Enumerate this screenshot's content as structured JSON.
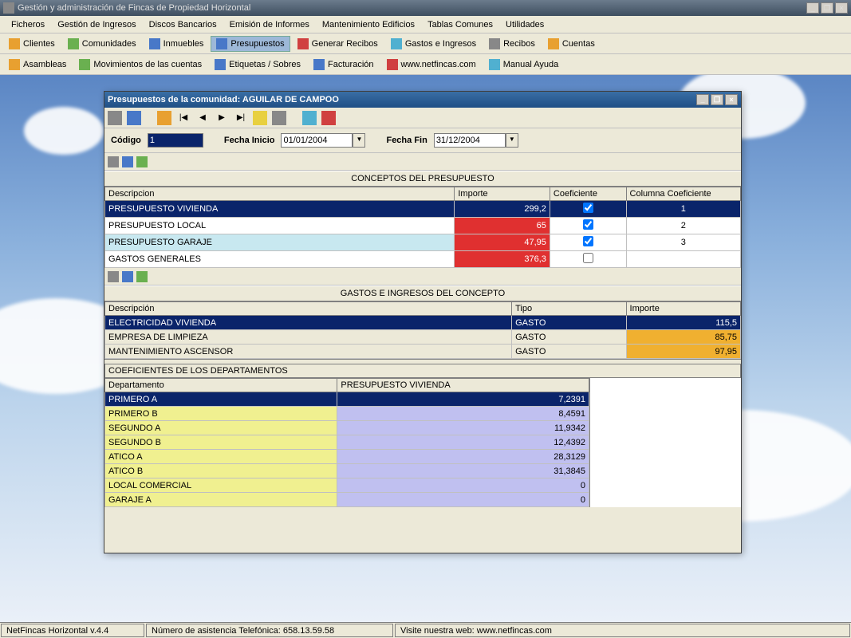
{
  "app": {
    "title": "Gestión y administración de Fincas de Propiedad Horizontal"
  },
  "menu": [
    "Ficheros",
    "Gestión de Ingresos",
    "Discos Bancarios",
    "Emisión de Informes",
    "Mantenimiento Edificios",
    "Tablas Comunes",
    "Utilidades"
  ],
  "toolbar1": [
    "Clientes",
    "Comunidades",
    "Inmuebles",
    "Presupuestos",
    "Generar Recibos",
    "Gastos e Ingresos",
    "Recibos",
    "Cuentas"
  ],
  "toolbar1_active": 3,
  "toolbar2": [
    "Asambleas",
    "Movimientos de las cuentas",
    "Etiquetas / Sobres",
    "Facturación",
    "www.netfincas.com",
    "Manual Ayuda"
  ],
  "inner": {
    "title": "Presupuestos de la comunidad: AGUILAR DE CAMPOO",
    "codigo_label": "Código",
    "codigo_value": "1",
    "fecha_inicio_label": "Fecha Inicio",
    "fecha_inicio_value": "01/01/2004",
    "fecha_fin_label": "Fecha Fin",
    "fecha_fin_value": "31/12/2004"
  },
  "conceptos": {
    "title": "CONCEPTOS DEL PRESUPUESTO",
    "cols": [
      "Descripcion",
      "Importe",
      "Coeficiente",
      "Columna Coeficiente"
    ],
    "rows": [
      {
        "desc": "PRESUPUESTO VIVIENDA",
        "importe": "299,2",
        "coef": true,
        "col": "1",
        "sel": true,
        "red": false
      },
      {
        "desc": "PRESUPUESTO LOCAL",
        "importe": "65",
        "coef": true,
        "col": "2",
        "sel": false,
        "red": true
      },
      {
        "desc": "PRESUPUESTO GARAJE",
        "importe": "47,95",
        "coef": true,
        "col": "3",
        "sel": false,
        "red": true
      },
      {
        "desc": "GASTOS GENERALES",
        "importe": "376,3",
        "coef": false,
        "col": "",
        "sel": false,
        "red": true
      }
    ]
  },
  "gastos": {
    "title": "GASTOS E INGRESOS DEL CONCEPTO",
    "cols": [
      "Descripción",
      "Tipo",
      "Importe"
    ],
    "rows": [
      {
        "desc": "ELECTRICIDAD VIVIENDA",
        "tipo": "GASTO",
        "importe": "115,5",
        "sel": true,
        "hl": false
      },
      {
        "desc": "EMPRESA DE LIMPIEZA",
        "tipo": "GASTO",
        "importe": "85,75",
        "sel": false,
        "hl": true
      },
      {
        "desc": "MANTENIMIENTO ASCENSOR",
        "tipo": "GASTO",
        "importe": "97,95",
        "sel": false,
        "hl": true
      }
    ]
  },
  "coef": {
    "title": "COEFICIENTES DE LOS DEPARTAMENTOS",
    "cols": [
      "Departamento",
      "PRESUPUESTO VIVIENDA"
    ],
    "rows": [
      {
        "dept": "PRIMERO A",
        "val": "7,2391",
        "sel": true
      },
      {
        "dept": "PRIMERO B",
        "val": "8,4591",
        "sel": false
      },
      {
        "dept": "SEGUNDO A",
        "val": "11,9342",
        "sel": false
      },
      {
        "dept": "SEGUNDO B",
        "val": "12,4392",
        "sel": false
      },
      {
        "dept": "ATICO A",
        "val": "28,3129",
        "sel": false
      },
      {
        "dept": "ATICO B",
        "val": "31,3845",
        "sel": false
      },
      {
        "dept": "LOCAL COMERCIAL",
        "val": "0",
        "sel": false
      },
      {
        "dept": "GARAJE A",
        "val": "0",
        "sel": false
      }
    ]
  },
  "status": {
    "left": "NetFincas Horizontal v.4.4",
    "mid": "Número de asistencia Telefónica: 658.13.59.58",
    "right": "Visite nuestra web: www.netfincas.com"
  }
}
